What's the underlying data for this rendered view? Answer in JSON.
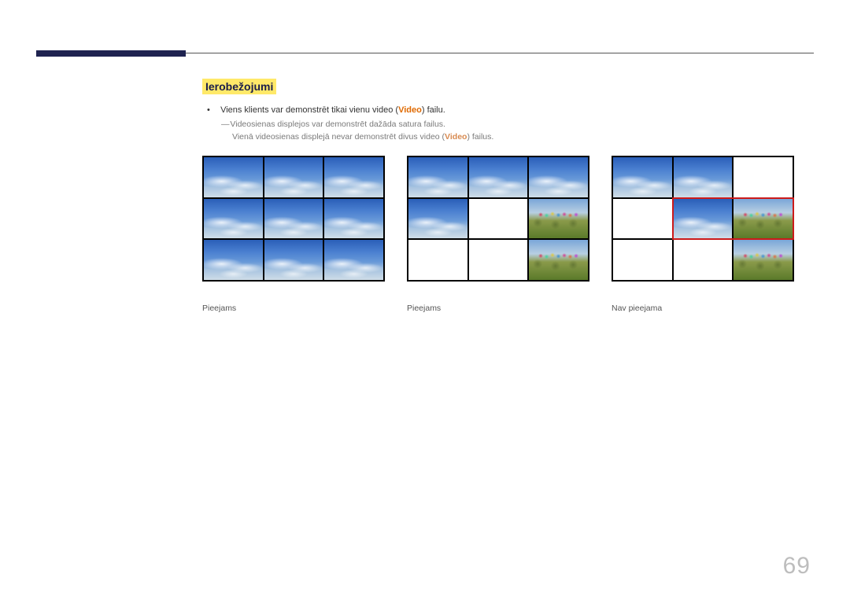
{
  "heading": "Ierobežojumi",
  "bullet": {
    "prefix": "Viens klients var demonstrēt tikai vienu video (",
    "bold": "Video",
    "suffix": ") failu."
  },
  "sub1": "Videosienas displejos var demonstrēt dažāda satura failus.",
  "sub2": {
    "prefix": "Vienā videosienas displejā nevar demonstrēt divus video (",
    "bold": "Video",
    "suffix": ") failus."
  },
  "captions": [
    "Pieejams",
    "Pieejams",
    "Nav pieejama"
  ],
  "page_number": "69"
}
